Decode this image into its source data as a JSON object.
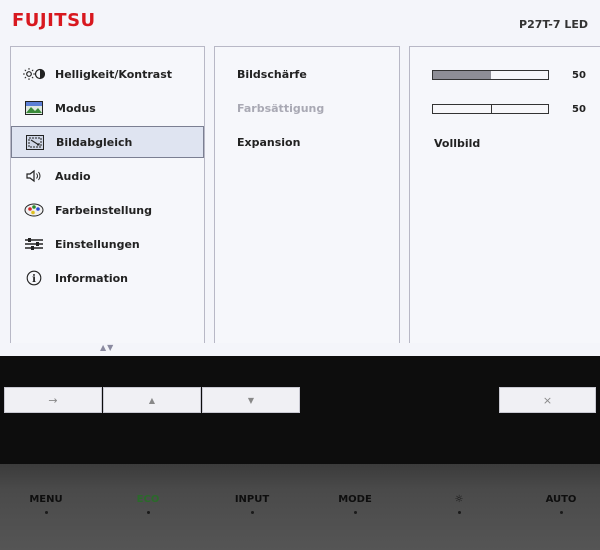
{
  "header": {
    "brand": "FUJITSU",
    "model": "P27T-7 LED"
  },
  "menu": {
    "items": [
      {
        "label": "Helligkeit/Kontrast",
        "icon": "brightness-contrast-icon",
        "selected": false
      },
      {
        "label": "Modus",
        "icon": "picture-mode-icon",
        "selected": false
      },
      {
        "label": "Bildabgleich",
        "icon": "image-adjust-icon",
        "selected": true
      },
      {
        "label": "Audio",
        "icon": "speaker-icon",
        "selected": false
      },
      {
        "label": "Farbeinstellung",
        "icon": "color-palette-icon",
        "selected": false
      },
      {
        "label": "Einstellungen",
        "icon": "settings-sliders-icon",
        "selected": false
      },
      {
        "label": "Information",
        "icon": "info-icon",
        "selected": false
      }
    ],
    "scroll_hint": "▲▼"
  },
  "submenu": {
    "items": [
      {
        "label": "Bildschärfe",
        "enabled": true
      },
      {
        "label": "Farbsättigung",
        "enabled": false
      },
      {
        "label": "Expansion",
        "enabled": true
      }
    ]
  },
  "values": {
    "sharpness": {
      "value": "50",
      "level": 0.5
    },
    "saturation": {
      "value": "50",
      "level": 0.5
    },
    "expansion": "Vollbild"
  },
  "softkeys": {
    "enter": "→",
    "up": "▲",
    "down": "▼",
    "close": "×"
  },
  "hardware_buttons": [
    "MENU",
    "ECO",
    "INPUT",
    "MODE",
    "☼",
    "AUTO"
  ],
  "colors": {
    "brand": "#d8181f",
    "eco": "#2a6a2a"
  }
}
